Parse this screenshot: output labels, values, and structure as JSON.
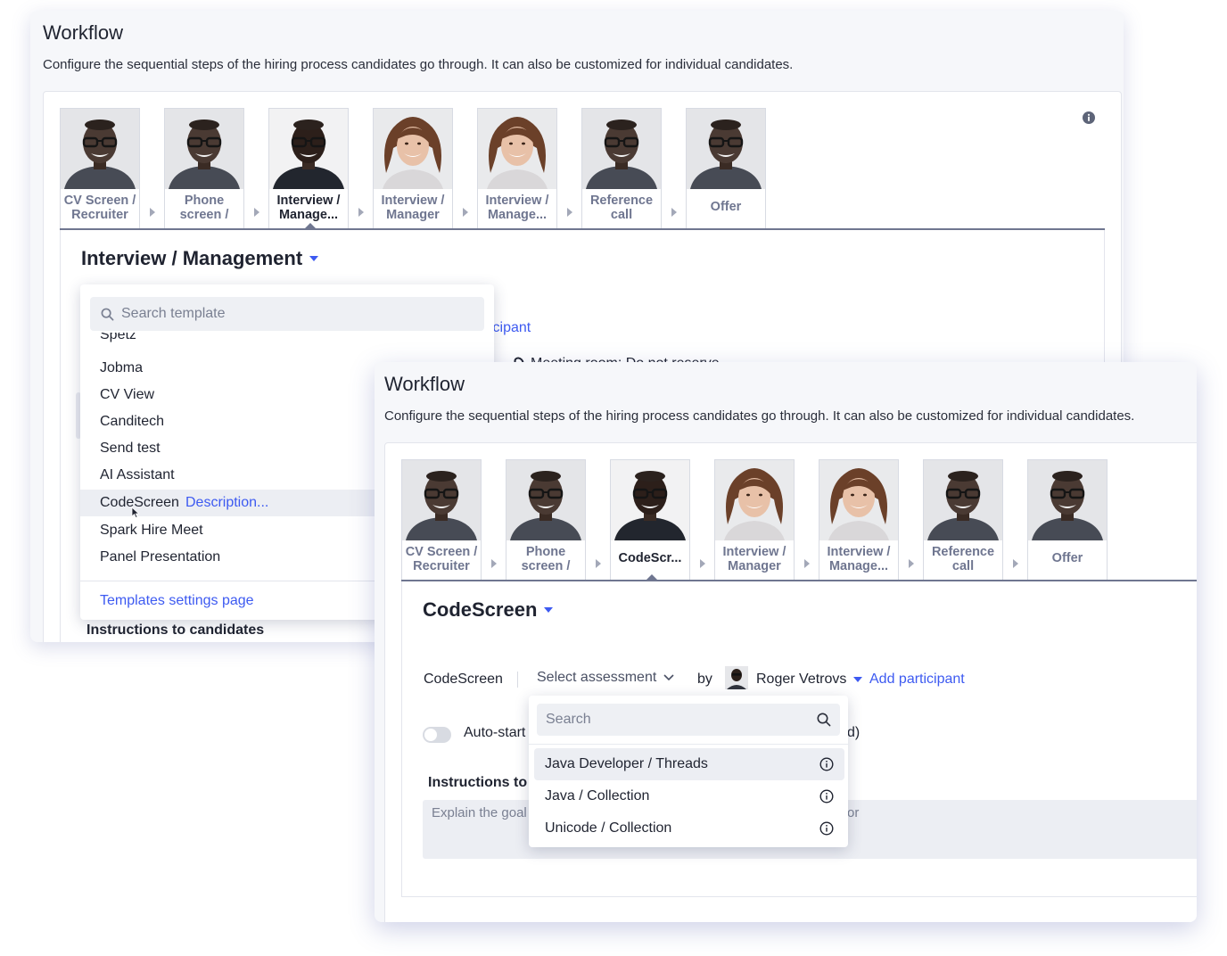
{
  "back": {
    "title": "Workflow",
    "description": "Configure the sequential steps of the hiring process candidates go through. It can also be customized for individual candidates.",
    "steps": [
      {
        "l1": "CV Screen /",
        "l2": "Recruiter"
      },
      {
        "l1": "Phone",
        "l2": "screen /"
      },
      {
        "l1": "Interview /",
        "l2": "Manage..."
      },
      {
        "l1": "Interview /",
        "l2": "Manager"
      },
      {
        "l1": "Interview /",
        "l2": "Manage..."
      },
      {
        "l1": "Reference",
        "l2": "call"
      },
      {
        "l1": "Offer"
      }
    ],
    "stage_title": "Interview / Management",
    "partial_link": "icipant",
    "partial_meeting": "Meeting room: Do not reserve",
    "instructions_label": "Instructions to candidates",
    "template_dropdown": {
      "search_placeholder": "Search template",
      "items": [
        "Spetz",
        "Jobma",
        "CV View",
        "Canditech",
        "Send test",
        "AI Assistant",
        "CodeScreen",
        "Spark Hire Meet",
        "Panel Presentation"
      ],
      "hover_desc": "Description...",
      "settings_link": "Templates settings page"
    }
  },
  "front": {
    "title": "Workflow",
    "description": "Configure the sequential steps of the hiring process candidates go through. It can also be customized for individual candidates.",
    "steps": [
      {
        "l1": "CV Screen /",
        "l2": "Recruiter"
      },
      {
        "l1": "Phone",
        "l2": "screen /"
      },
      {
        "l1": "CodeScr..."
      },
      {
        "l1": "Interview /",
        "l2": "Manager"
      },
      {
        "l1": "Interview /",
        "l2": "Manage..."
      },
      {
        "l1": "Reference",
        "l2": "call"
      },
      {
        "l1": "Offer"
      }
    ],
    "stage_title": "CodeScreen",
    "row": {
      "provider": "CodeScreen",
      "select_label": "Select assessment",
      "by": "by",
      "owner": "Roger Vetrovs",
      "add_participant": "Add participant"
    },
    "autostart_label": "Auto-start",
    "partial_right": "d)",
    "instructions_label": "Instructions to",
    "instructions_placeholder": "Explain the goal",
    "instructions_tail": "or",
    "assessment_dropdown": {
      "search_placeholder": "Search",
      "options": [
        "Java Developer / Threads",
        "Java / Collection",
        "Unicode / Collection"
      ]
    }
  },
  "colors": {
    "accent": "#3d5af1",
    "muted": "#6f7690",
    "panel_bg": "#f6f7fa"
  }
}
